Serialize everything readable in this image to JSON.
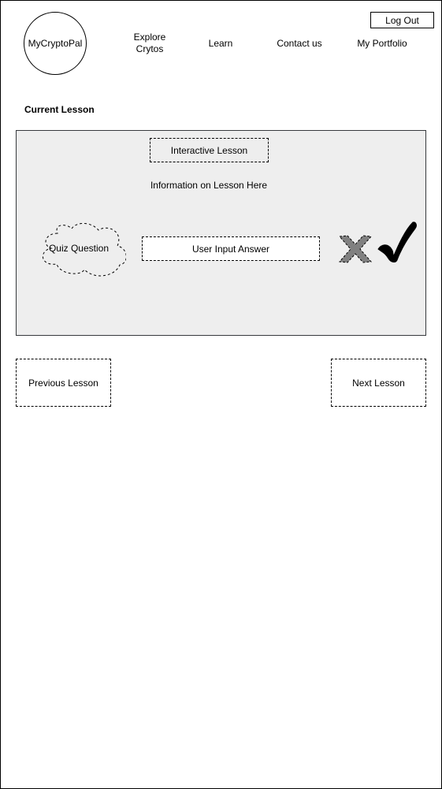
{
  "header": {
    "logo_text": "MyCryptoPal",
    "logout_label": "Log Out",
    "nav": {
      "explore": "Explore Crytos",
      "learn": "Learn",
      "contact": "Contact us",
      "portfolio": "My Portfolio"
    }
  },
  "lesson": {
    "section_title": "Current Lesson",
    "interactive_label": "Interactive Lesson",
    "info_text": "Information on Lesson Here",
    "quiz_label": "Quiz Question",
    "answer_label": "User Input Answer",
    "wrong_icon": "x-mark-icon",
    "correct_icon": "checkmark-icon"
  },
  "pagination": {
    "previous_label": "Previous Lesson",
    "next_label": "Next Lesson"
  },
  "colors": {
    "panel_background": "#eeeeee",
    "panel_border": "#36393d",
    "x_mark_fill": "#808080",
    "checkmark_fill": "#000000"
  }
}
